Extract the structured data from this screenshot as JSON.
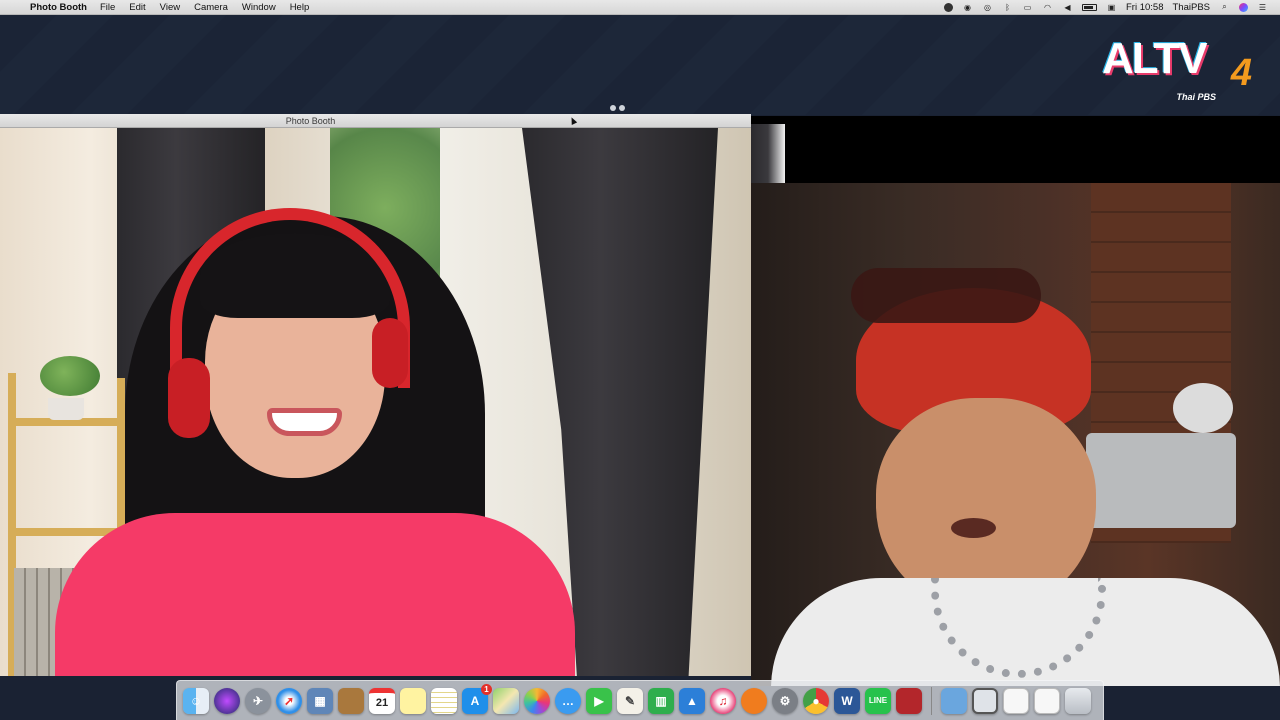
{
  "menubar": {
    "app_name": "Photo Booth",
    "menus": [
      "File",
      "Edit",
      "View",
      "Camera",
      "Window",
      "Help"
    ],
    "clock": "Fri 10:58",
    "user": "ThaiPBS"
  },
  "window": {
    "title": "Photo Booth"
  },
  "logo": {
    "main": "ALTV",
    "number": "4",
    "sub": "Thai PBS"
  },
  "dock": {
    "calendar_day": "21",
    "word_letter": "W",
    "appstore_badge": "1",
    "icons": [
      "finder-icon",
      "siri-icon",
      "launchpad-icon",
      "safari-icon",
      "preview-icon",
      "notes-book-icon",
      "calendar-icon",
      "stickies-icon",
      "notes-icon",
      "app-store-icon",
      "maps-icon",
      "photos-icon",
      "messages-icon",
      "facetime-icon",
      "textedit-icon",
      "numbers-icon",
      "keynote-icon",
      "itunes-icon",
      "ibooks-icon",
      "system-preferences-icon",
      "chrome-icon",
      "word-icon",
      "line-icon",
      "photo-booth-icon",
      "folder-icon",
      "screen-icon",
      "document-icon",
      "document-2-icon",
      "trash-icon"
    ]
  },
  "colors": {
    "menubar": "#dcdcdc",
    "desktop": "#1b2436",
    "dock": "#e1e4e8"
  }
}
